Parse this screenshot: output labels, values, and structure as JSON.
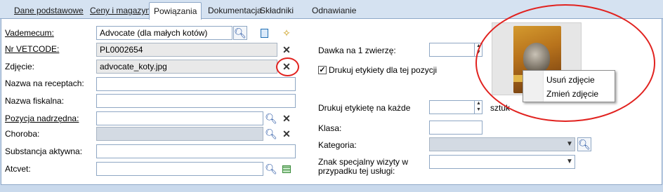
{
  "tabs": [
    {
      "label": "Dane podstawowe"
    },
    {
      "label": "Ceny i magazyn"
    },
    {
      "label": "Powiązania"
    },
    {
      "label": "Dokumentacja"
    },
    {
      "label": "Składniki"
    },
    {
      "label": "Odnawianie"
    }
  ],
  "active_tab": "Powiązania",
  "left": {
    "vademecum": {
      "label": "Vademecum:",
      "value": "Advocate (dla małych kotów)"
    },
    "vetcode": {
      "label": "Nr VETCODE:",
      "value": "PL0002654"
    },
    "photo": {
      "label": "Zdjęcie:",
      "value": "advocate_koty.jpg"
    },
    "prescription_name": {
      "label": "Nazwa na receptach:",
      "value": ""
    },
    "fiscal_name": {
      "label": "Nazwa fiskalna:",
      "value": ""
    },
    "parent_item": {
      "label": "Pozycja nadrzędna:",
      "value": ""
    },
    "disease": {
      "label": "Choroba:",
      "value": ""
    },
    "active_substance": {
      "label": "Substancja aktywna:",
      "value": ""
    },
    "atcvet": {
      "label": "Atcvet:",
      "value": ""
    }
  },
  "right": {
    "dose": {
      "label": "Dawka na 1 zwierzę:",
      "value": ""
    },
    "print_labels": {
      "label": "Drukuj etykiety dla tej pozycji",
      "checked": true
    },
    "print_every": {
      "label": "Drukuj etykietę na każde",
      "value": "",
      "unit": "sztuk"
    },
    "class": {
      "label": "Klasa:",
      "value": ""
    },
    "category": {
      "label": "Kategoria:",
      "value": ""
    },
    "special_sign": {
      "label": "Znak specjalny wizyty w przypadku tej usługi:",
      "line1": "Znak specjalny wizyty w",
      "line2": "przypadku tej usługi:",
      "value": ""
    }
  },
  "context_menu": {
    "items": [
      {
        "label": "Usuń zdjęcie"
      },
      {
        "label": "Zmień zdjęcie"
      }
    ]
  },
  "colors": {
    "annotation": "#e1221f",
    "accent": "#1f4fa0"
  }
}
